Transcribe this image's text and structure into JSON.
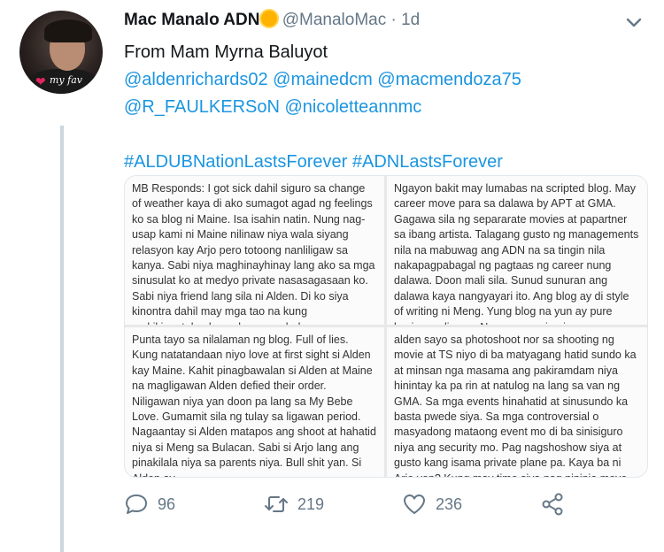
{
  "tweet": {
    "author_name": "Mac Manalo ADN",
    "handle": "@ManaloMac",
    "separator": "·",
    "time": "1d",
    "avatar_caption": "my fav",
    "line1": "From Mam Myrna Baluyot",
    "mentions_line1": "@aldenrichards02 @mainedcm @macmendoza75",
    "mentions_line2": "@R_FAULKERSoN @nicoletteannmc",
    "hashtags": "#ALDUBNationLastsForever #ADNLastsForever"
  },
  "media": {
    "panel1": "MB Responds: I got sick dahil siguro sa change of weather kaya di ako sumagot agad ng feelings ko sa blog ni Maine. Isa isahin natin. Nung nag-usap kami ni Maine nilinaw niya wala siyang relasyon kay Arjo pero totoong nanliligaw sa kanya. Sabi niya maghinayhinay lang ako sa mga sinusulat ko at medyo private nasasagasaan ko. Sabi niya friend lang sila ni Alden. Di ko siya kinontra dahil may mga tao na kung makikinagtalo ako sa kanya ay baka may",
    "panel2": "Ngayon bakit may lumabas na scripted blog. May career move para sa dalawa by APT at GMA. Gagawa sila ng separarate movies at papartner sa ibang artista. Talagang gusto ng managements nila na mabuwag ang ADN na sa tingin nila nakapagpabagal ng pagtaas ng career nung dalawa. Doon mali sila. Sunud sunuran ang dalawa kaya nangyayari ito. Ang blog ay di style of writing ni Meng. Yung blog na yun ay pure kasinungalingan. Never nagawin ni",
    "panel3": "Punta tayo sa nilalaman ng blog. Full of lies. Kung natatandaan niyo love at first sight si Alden kay Maine. Kahit pinagbawalan si Alden at Maine na magligawan Alden defied their order. Niligawan niya yan doon pa lang sa My Bebe Love. Gumamit sila ng tulay sa ligawan period. Nagaantay si Alden matapos ang shoot at hahatid niya si Meng sa Bulacan. Sabi si Arjo lang ang pinakilala niya sa parents niya. Bull shit yan. Si Alden ay",
    "panel4": "alden sayo sa photoshoot nor sa shooting ng movie at TS niyo di ba matyagang hatid sundo ka at minsan nga masama ang pakiramdam niya hinintay ka pa rin at natulog na lang sa van ng GMA. Sa mga events hinahatid at sinusundo ka basta pwede siya. Sa mga controversial o masyadong mataong event mo di ba sinisiguro niya ang security mo. Pag nagshoshow siya at gusto kang isama private plane pa. Kaya ba ni Arjo yon? Kung may time siya nag nininja move kaya sa Bataan, Batangas. Amanpulo at ibang"
  },
  "actions": {
    "replies": "96",
    "retweets": "219",
    "likes": "236"
  },
  "colors": {
    "link": "#1b95e0",
    "secondary_text": "#657786",
    "thread_line": "#ccd6dd"
  },
  "icons": [
    "chevron-down-icon",
    "reply-icon",
    "retweet-icon",
    "like-icon",
    "share-icon"
  ]
}
